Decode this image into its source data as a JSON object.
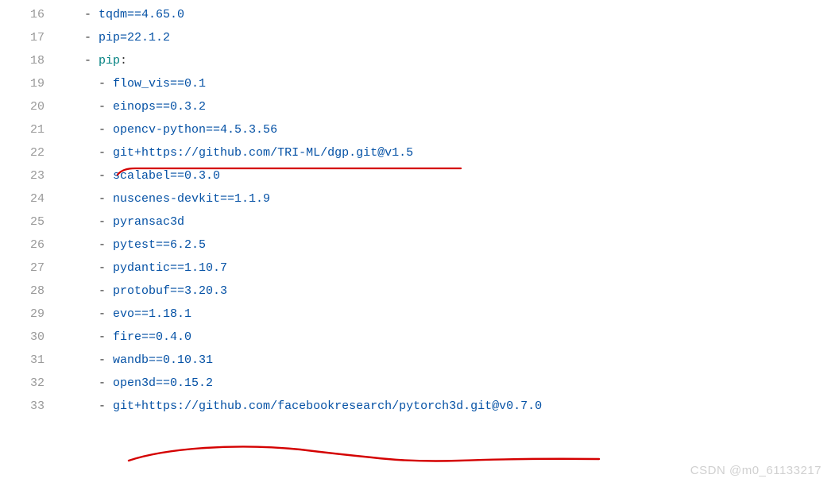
{
  "lines": [
    {
      "num": "16",
      "prefix": "  ",
      "tokens": [
        {
          "t": "dash",
          "v": "- "
        },
        {
          "t": "string",
          "v": "tqdm==4.65.0"
        }
      ]
    },
    {
      "num": "17",
      "prefix": "  ",
      "tokens": [
        {
          "t": "dash",
          "v": "- "
        },
        {
          "t": "string",
          "v": "pip=22.1.2"
        }
      ]
    },
    {
      "num": "18",
      "prefix": "  ",
      "tokens": [
        {
          "t": "dash",
          "v": "- "
        },
        {
          "t": "key",
          "v": "pip"
        },
        {
          "t": "dash",
          "v": ":"
        }
      ]
    },
    {
      "num": "19",
      "prefix": "    ",
      "tokens": [
        {
          "t": "dash",
          "v": "- "
        },
        {
          "t": "string",
          "v": "flow_vis==0.1"
        }
      ]
    },
    {
      "num": "20",
      "prefix": "    ",
      "tokens": [
        {
          "t": "dash",
          "v": "- "
        },
        {
          "t": "string",
          "v": "einops==0.3.2"
        }
      ]
    },
    {
      "num": "21",
      "prefix": "    ",
      "tokens": [
        {
          "t": "dash",
          "v": "- "
        },
        {
          "t": "string",
          "v": "opencv-python==4.5.3.56"
        }
      ]
    },
    {
      "num": "22",
      "prefix": "    ",
      "tokens": [
        {
          "t": "dash",
          "v": "- "
        },
        {
          "t": "string",
          "v": "git+https://github.com/TRI-ML/dgp.git@v1.5"
        }
      ]
    },
    {
      "num": "23",
      "prefix": "    ",
      "tokens": [
        {
          "t": "dash",
          "v": "- "
        },
        {
          "t": "string",
          "v": "scalabel==0.3.0"
        }
      ]
    },
    {
      "num": "24",
      "prefix": "    ",
      "tokens": [
        {
          "t": "dash",
          "v": "- "
        },
        {
          "t": "string",
          "v": "nuscenes-devkit==1.1.9"
        }
      ]
    },
    {
      "num": "25",
      "prefix": "    ",
      "tokens": [
        {
          "t": "dash",
          "v": "- "
        },
        {
          "t": "string",
          "v": "pyransac3d"
        }
      ]
    },
    {
      "num": "26",
      "prefix": "    ",
      "tokens": [
        {
          "t": "dash",
          "v": "- "
        },
        {
          "t": "string",
          "v": "pytest==6.2.5"
        }
      ]
    },
    {
      "num": "27",
      "prefix": "    ",
      "tokens": [
        {
          "t": "dash",
          "v": "- "
        },
        {
          "t": "string",
          "v": "pydantic==1.10.7"
        }
      ]
    },
    {
      "num": "28",
      "prefix": "    ",
      "tokens": [
        {
          "t": "dash",
          "v": "- "
        },
        {
          "t": "string",
          "v": "protobuf==3.20.3"
        }
      ]
    },
    {
      "num": "29",
      "prefix": "    ",
      "tokens": [
        {
          "t": "dash",
          "v": "- "
        },
        {
          "t": "string",
          "v": "evo==1.18.1"
        }
      ]
    },
    {
      "num": "30",
      "prefix": "    ",
      "tokens": [
        {
          "t": "dash",
          "v": "- "
        },
        {
          "t": "string",
          "v": "fire==0.4.0"
        }
      ]
    },
    {
      "num": "31",
      "prefix": "    ",
      "tokens": [
        {
          "t": "dash",
          "v": "- "
        },
        {
          "t": "string",
          "v": "wandb==0.10.31"
        }
      ]
    },
    {
      "num": "32",
      "prefix": "    ",
      "tokens": [
        {
          "t": "dash",
          "v": "- "
        },
        {
          "t": "string",
          "v": "open3d==0.15.2"
        }
      ]
    },
    {
      "num": "33",
      "prefix": "    ",
      "tokens": [
        {
          "t": "dash",
          "v": "- "
        },
        {
          "t": "string",
          "v": "git+https://github.com/facebookresearch/pytorch3d.git@v0.7.0"
        }
      ]
    }
  ],
  "watermark": "CSDN @m0_61133217"
}
